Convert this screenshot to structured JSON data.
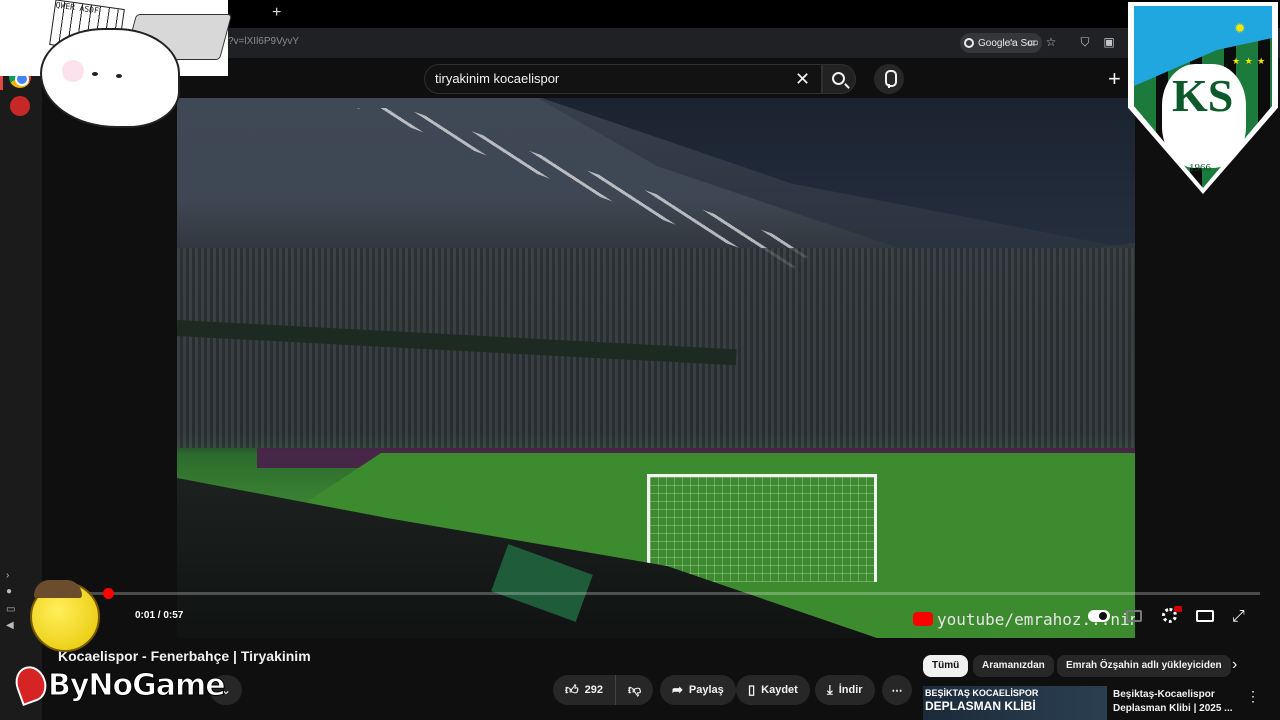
{
  "browser": {
    "new_tab_label": "+",
    "url_text": "?v=lXIl6P9VyvY",
    "google_search_label": "Google'a Sor"
  },
  "search": {
    "value": "tiryakinim kocaelispor",
    "clear_label": "✕"
  },
  "header": {
    "create_label": "+"
  },
  "player": {
    "time_display": "0:01 / 0:57",
    "watermark": "youtube/emrahoz...nin",
    "progress": 0.017
  },
  "video": {
    "title": "Kocaelispor - Fenerbahçe | Tiryakinim"
  },
  "actions": {
    "like_count": "292",
    "share_label": "Paylaş",
    "save_label": "Kaydet",
    "download_label": "İndir",
    "more_label": "⋯"
  },
  "chips": [
    {
      "label": "Tümü",
      "active": true
    },
    {
      "label": "Aramanızdan",
      "active": false
    },
    {
      "label": "Emrah Özşahin adlı yükleyiciden",
      "active": false
    }
  ],
  "recommended": {
    "thumb_line1": "BEŞİKTAŞ KOCAELİSPOR",
    "thumb_line2": "DEPLASMAN KLİBİ",
    "title": "Beşiktaş-Kocaelispor Deplasman Klibi | 2025 ..."
  },
  "overlays": {
    "club_crest_letters": "KS",
    "club_crest_year": "1966",
    "stream_logo": "ByNoGame",
    "keyboard_keys": "QWER ASDF"
  },
  "colors": {
    "accent": "#ff0000",
    "background": "#0f0f0f",
    "club_green": "#1c7a3c"
  }
}
